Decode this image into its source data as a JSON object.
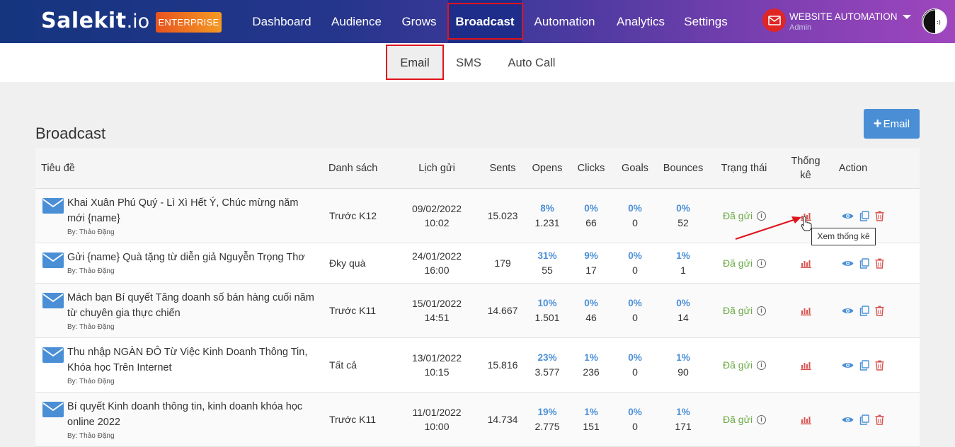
{
  "brand": {
    "logo_main": "Salekit",
    "logo_suffix": ".io",
    "plan_badge": "ENTERPRISE"
  },
  "nav": {
    "items": [
      {
        "label": "Dashboard"
      },
      {
        "label": "Audience"
      },
      {
        "label": "Grows"
      },
      {
        "label": "Broadcast",
        "active": true
      },
      {
        "label": "Automation"
      },
      {
        "label": "Analytics"
      },
      {
        "label": "Settings"
      }
    ]
  },
  "account": {
    "name": "WEBSITE AUTOMATION",
    "role": "Admin",
    "icon": "mail-icon"
  },
  "subnav": {
    "items": [
      {
        "label": "Email",
        "active": true
      },
      {
        "label": "SMS"
      },
      {
        "label": "Auto Call"
      }
    ]
  },
  "page": {
    "title": "Broadcast",
    "add_button": "Email"
  },
  "table": {
    "headers": {
      "title": "Tiêu đề",
      "list": "Danh sách",
      "schedule": "Lịch gửi",
      "sents": "Sents",
      "opens": "Opens",
      "clicks": "Clicks",
      "goals": "Goals",
      "bounces": "Bounces",
      "status": "Trạng thái",
      "stats_line1": "Thống",
      "stats_line2": "kê",
      "action": "Action"
    },
    "rows": [
      {
        "title": "Khai Xuân Phú Quý - Lì Xì Hết Ý, Chúc mừng năm mới {name}",
        "by": "By: Thảo Đặng",
        "list": "Trước K12",
        "date": "09/02/2022",
        "time": "10:02",
        "sents": "15.023",
        "opens_pct": "8%",
        "opens": "1.231",
        "clicks_pct": "0%",
        "clicks": "66",
        "goals_pct": "0%",
        "goals": "0",
        "bounces_pct": "0%",
        "bounces": "52",
        "status": "Đã gửi"
      },
      {
        "title": "Gửi {name} Quà tặng từ diễn giả Nguyễn Trọng Thơ",
        "by": "By: Thảo Đặng",
        "list": "Đky quà",
        "date": "24/01/2022",
        "time": "16:00",
        "sents": "179",
        "opens_pct": "31%",
        "opens": "55",
        "clicks_pct": "9%",
        "clicks": "17",
        "goals_pct": "0%",
        "goals": "0",
        "bounces_pct": "1%",
        "bounces": "1",
        "status": "Đã gửi"
      },
      {
        "title": "Mách bạn Bí quyết Tăng doanh số bán hàng cuối năm từ chuyên gia thực chiến",
        "by": "By: Thảo Đặng",
        "list": "Trước K11",
        "date": "15/01/2022",
        "time": "14:51",
        "sents": "14.667",
        "opens_pct": "10%",
        "opens": "1.501",
        "clicks_pct": "0%",
        "clicks": "46",
        "goals_pct": "0%",
        "goals": "0",
        "bounces_pct": "0%",
        "bounces": "14",
        "status": "Đã gửi"
      },
      {
        "title": "Thu nhập NGÀN ĐÔ Từ Việc Kinh Doanh Thông Tin, Khóa học Trên Internet",
        "by": "By: Thảo Đặng",
        "list": "Tất cả",
        "date": "13/01/2022",
        "time": "10:15",
        "sents": "15.816",
        "opens_pct": "23%",
        "opens": "3.577",
        "clicks_pct": "1%",
        "clicks": "236",
        "goals_pct": "0%",
        "goals": "0",
        "bounces_pct": "1%",
        "bounces": "90",
        "status": "Đã gửi"
      },
      {
        "title": "Bí quyết Kinh doanh thông tin, kinh doanh khóa học online 2022",
        "by": "By: Thảo Đặng",
        "list": "Trước K11",
        "date": "11/01/2022",
        "time": "10:00",
        "sents": "14.734",
        "opens_pct": "19%",
        "opens": "2.775",
        "clicks_pct": "1%",
        "clicks": "151",
        "goals_pct": "0%",
        "goals": "0",
        "bounces_pct": "1%",
        "bounces": "171",
        "status": "Đã gửi"
      }
    ]
  },
  "tooltip": "Xem thống kê",
  "colors": {
    "accent": "#4a8fd6",
    "status_sent": "#6aaa45",
    "stats_icon": "#d9534f",
    "delete_icon": "#d9534f",
    "highlight": "#e0131d"
  }
}
